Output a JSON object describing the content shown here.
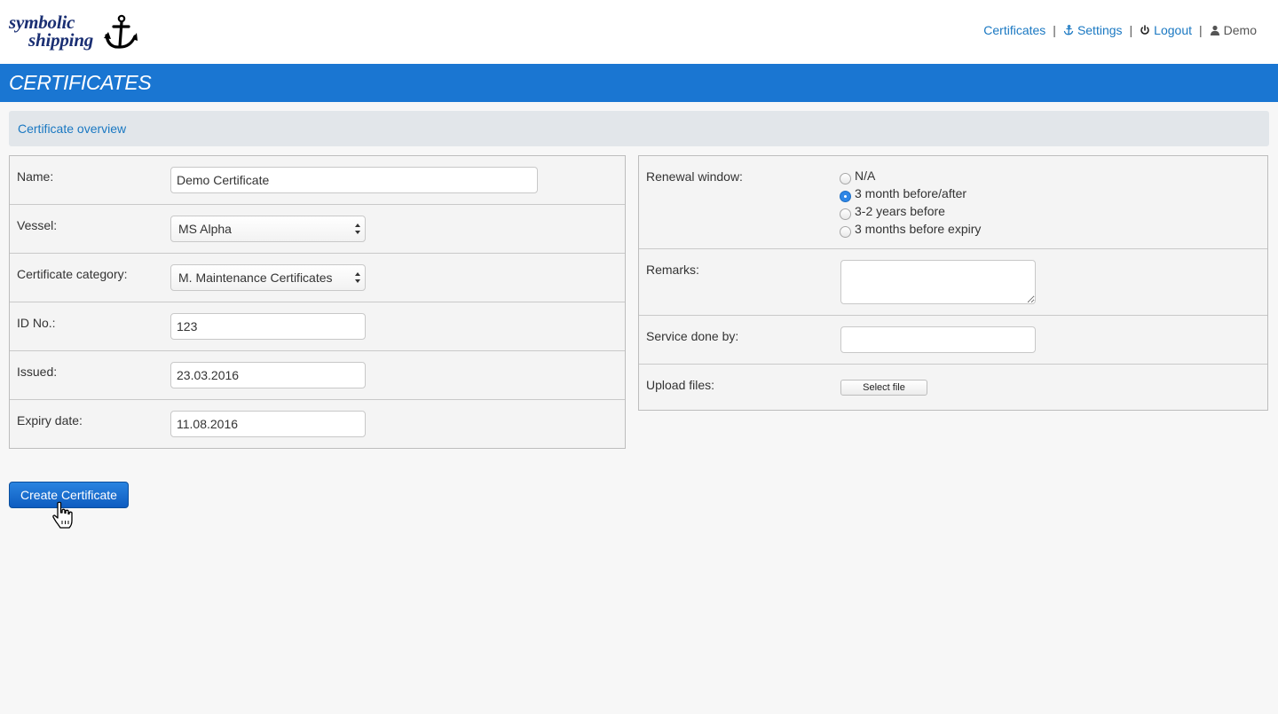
{
  "brand": {
    "line1": "symbolic",
    "line2": "shipping",
    "icon": "anchor-icon"
  },
  "nav": {
    "certificates": "Certificates",
    "settings": "Settings",
    "logout": "Logout",
    "user": "Demo",
    "separator": "|"
  },
  "page_title": "CERTIFICATES",
  "overview_label": "Certificate overview",
  "form_left": {
    "name_label": "Name:",
    "name_value": "Demo Certificate",
    "vessel_label": "Vessel:",
    "vessel_value": "MS Alpha",
    "category_label": "Certificate category:",
    "category_value": "M. Maintenance Certificates",
    "id_label": "ID No.:",
    "id_value": "123",
    "issued_label": "Issued:",
    "issued_value": "23.03.2016",
    "expiry_label": "Expiry date:",
    "expiry_value": "11.08.2016"
  },
  "form_right": {
    "renewal_label": "Renewal window:",
    "renewal_options": [
      "N/A",
      "3 month before/after",
      "3-2 years before",
      "3 months before expiry"
    ],
    "renewal_selected": "3 month before/after",
    "remarks_label": "Remarks:",
    "remarks_value": "",
    "service_label": "Service done by:",
    "service_value": "",
    "upload_label": "Upload files:",
    "select_file_label": "Select file"
  },
  "submit_label": "Create Certificate",
  "colors": {
    "accent": "#1a76d2",
    "link": "#1a78c2",
    "brand": "#1a2f73"
  }
}
